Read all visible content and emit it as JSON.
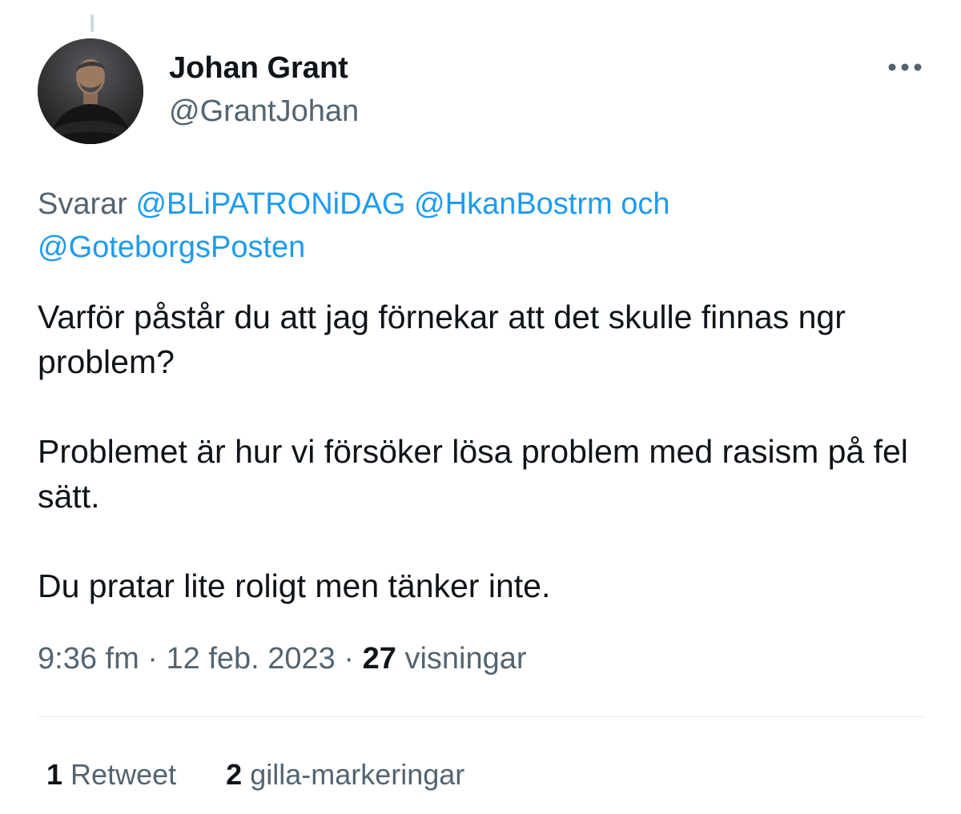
{
  "author": {
    "display_name": "Johan Grant",
    "handle": "@GrantJohan",
    "avatar_icon": "profile-photo"
  },
  "reply": {
    "prefix": "Svarar",
    "mentions": [
      "@BLiPATRONiDAG",
      "@HkanBostrm"
    ],
    "conjunction": "och",
    "last_mention": "@GoteborgsPosten"
  },
  "tweet": {
    "paragraphs": [
      "Varför påstår du att jag förnekar att det skulle finnas ngr problem?",
      "Problemet är hur vi försöker lösa problem med rasism på fel sätt.",
      "Du pratar lite roligt men tänker inte."
    ]
  },
  "meta": {
    "time": "9:36 fm",
    "separator": "·",
    "date": "12 feb. 2023",
    "views_count": "27",
    "views_label": "visningar"
  },
  "stats": {
    "retweets_count": "1",
    "retweets_label": "Retweet",
    "likes_count": "2",
    "likes_label": "gilla-markeringar"
  },
  "colors": {
    "text": "#0f1419",
    "secondary": "#536471",
    "link": "#1d9bf0",
    "divider": "#e6ecf0"
  },
  "icons": {
    "more": "more-horizontal-icon"
  }
}
